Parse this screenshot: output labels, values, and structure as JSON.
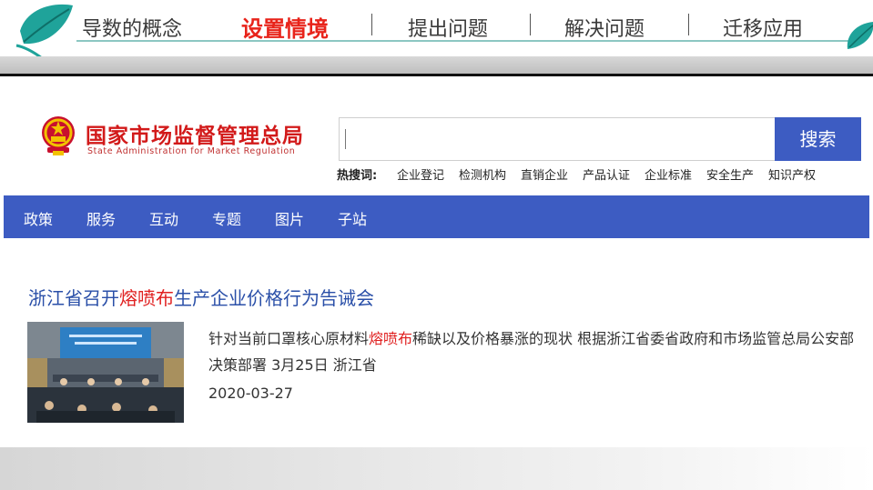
{
  "slide": {
    "nav": [
      {
        "label": "导数的概念"
      },
      {
        "label": "设置情境",
        "active": true
      },
      {
        "label": "提出问题"
      },
      {
        "label": "解决问题"
      },
      {
        "label": "迁移应用"
      }
    ],
    "colors": {
      "active": "#e8231a",
      "teal": "#8cc7c2",
      "leaf": "#1fa39a"
    }
  },
  "site": {
    "org_name": "国家市场监督管理总局",
    "org_name_en": "State Administration for Market Regulation",
    "search": {
      "placeholder": "",
      "value": "",
      "button_label": "搜索"
    },
    "hot_label": "热搜词:",
    "hot_words": [
      "企业登记",
      "检测机构",
      "直销企业",
      "产品认证",
      "企业标准",
      "安全生产",
      "知识产权"
    ],
    "nav": [
      "政策",
      "服务",
      "互动",
      "专题",
      "图片",
      "子站"
    ],
    "article": {
      "title_before": "浙江省召开",
      "title_highlight": "熔喷布",
      "title_after": "生产企业价格行为告诫会",
      "excerpt_before": "针对当前口罩核心原材料",
      "excerpt_highlight": "熔喷布",
      "excerpt_after": "稀缺以及价格暴涨的现状 根据浙江省委省政府和市场监管总局公安部决策部署 3月25日 浙江省",
      "date": "2020-03-27"
    },
    "colors": {
      "brand_blue": "#3d5cc2",
      "title_blue": "#2a4fa8",
      "highlight_red": "#e02020",
      "logo_red": "#d21a1a"
    }
  }
}
